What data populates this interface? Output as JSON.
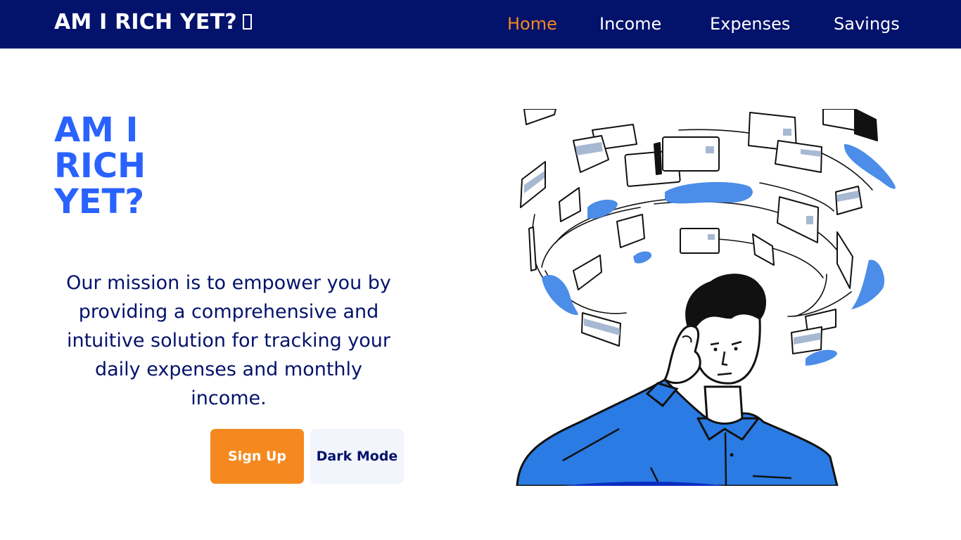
{
  "nav": {
    "brand": "AM I RICH YET?",
    "links": [
      {
        "label": "Home",
        "active": true
      },
      {
        "label": "Income",
        "active": false
      },
      {
        "label": "Expenses",
        "active": false
      },
      {
        "label": "Savings",
        "active": false
      }
    ]
  },
  "hero": {
    "title_lines": [
      "AM I",
      "RICH",
      "YET?"
    ],
    "mission": "Our mission is to empower you by providing a comprehensive and intuitive solution for tracking your daily expenses and monthly income.",
    "buttons": {
      "signup": "Sign Up",
      "dark_mode": "Dark Mode"
    }
  },
  "illustration": {
    "icon": "person-thinking-among-flying-cards-illustration"
  },
  "colors": {
    "nav_bg": "#03126b",
    "accent_orange": "#f5891f",
    "title_blue": "#2962ff",
    "text_navy": "#03126b",
    "illustration_blue": "#2a7be4"
  }
}
